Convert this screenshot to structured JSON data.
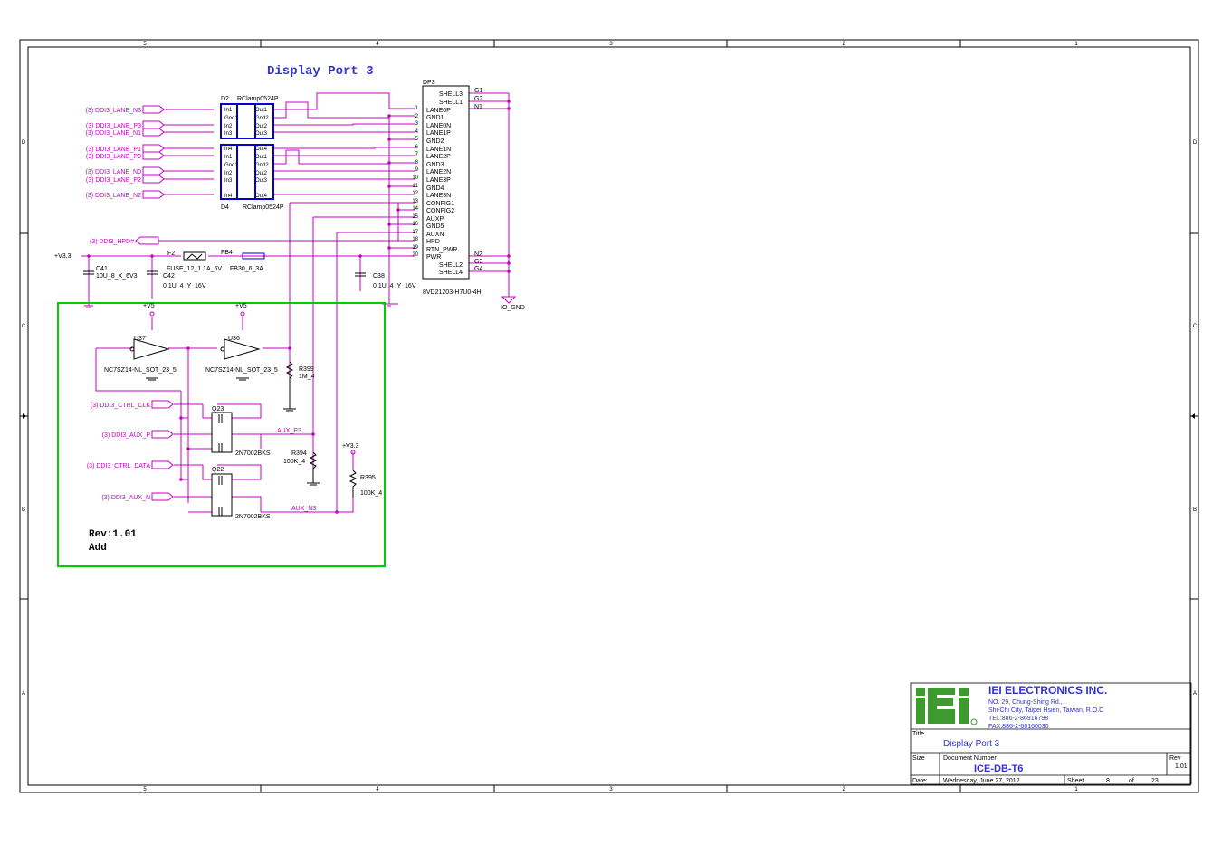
{
  "sheet": {
    "title": "Display Port 3",
    "border_cols": [
      "5",
      "4",
      "3",
      "2",
      "1"
    ],
    "border_rows": [
      "D",
      "C",
      "B",
      "A"
    ],
    "rev_note": [
      "Rev:1.01",
      "Add"
    ]
  },
  "nets": {
    "left_inputs": [
      "(3)  DDI3_LANE_N3",
      "(3)  DDI3_LANE_P3",
      "(3)  DDI3_LANE_N1",
      "(3)  DDI3_LANE_P1",
      "(3)  DDI3_LANE_P0",
      "(3)  DDI3_LANE_N0",
      "(3)  DDI3_LANE_P2",
      "(3)  DDI3_LANE_N2"
    ],
    "hpd": "(3)  DDI3_HPD#",
    "ctrl": [
      "(3)   DDI3_CTRL_CLK",
      "(3)   DDI3_AUX_P",
      "(3)   DDI3_CTRL_DATA",
      "(3)   DDI3_AUX_N"
    ],
    "aux_p": "AUX_P3",
    "aux_n": "AUX_N3",
    "io_gnd": "IO_GND",
    "v33": "+V3.3",
    "v5": "+V5"
  },
  "parts": {
    "d2": {
      "ref": "D2",
      "value": "RClamp0524P"
    },
    "d4": {
      "ref": "D4",
      "value": "RClamp0524P"
    },
    "clamp_pins_left": [
      "In1",
      "Gnd1",
      "In2",
      "In3",
      "In4"
    ],
    "clamp_pins_right": [
      "Out1",
      "Gnd2",
      "Out2",
      "Out3",
      "Out4"
    ],
    "dp3": {
      "ref": "DP3",
      "value": "8VD21203-H7U0-4H"
    },
    "dp3_pins": [
      "SHELL3",
      "SHELL1",
      "LANE0P",
      "GND1",
      "LANE0N",
      "LANE1P",
      "GND2",
      "LANE1N",
      "LANE2P",
      "GND3",
      "LANE2N",
      "LANE3P",
      "GND4",
      "LANE3N",
      "CONFIG1",
      "CONFIG2",
      "AUXP",
      "GND5",
      "AUXN",
      "HPD",
      "RTN_PWR",
      "PWR",
      "SHELL2",
      "SHELL4"
    ],
    "g_labels": [
      "G1",
      "G2",
      "N1",
      "N2",
      "G3",
      "G4"
    ],
    "f2": {
      "ref": "F2",
      "value": "FUSE_12_1.1A_6V"
    },
    "fb4": {
      "ref": "FB4",
      "value": "FB30_6_3A"
    },
    "c41": {
      "ref": "C41",
      "value": "10U_8_X_6V3"
    },
    "c42": {
      "ref": "C42",
      "value": "0.1U_4_Y_16V"
    },
    "c38": {
      "ref": "C38",
      "value": "0.1U_4_Y_16V"
    },
    "u37": {
      "ref": "U37",
      "value": "NC7SZ14-NL_SOT_23_5"
    },
    "u36": {
      "ref": "U36",
      "value": "NC7SZ14-NL_SOT_23_5"
    },
    "r399": {
      "ref": "R399",
      "value": "1M_4"
    },
    "r394": {
      "ref": "R394",
      "value": "100K_4"
    },
    "r395": {
      "ref": "R395",
      "value": "100K_4"
    },
    "q23": {
      "ref": "Q23",
      "value": "2N7002BKS"
    },
    "q22": {
      "ref": "Q22",
      "value": "2N7002BKS"
    }
  },
  "titleblock": {
    "logo": "iEi",
    "company": "IEI ELECTRONICS INC.",
    "address": [
      "NO. 29, Chung-Shing Rd.,",
      "Shi-Chi City, Taipei Hsien, Taiwan, R.O.C",
      "TEL:886-2-86916798",
      "FAX:886-2-66160030"
    ],
    "title_label": "Title",
    "title": "Display Port 3",
    "size_label": "Size",
    "docnum_label": "Document Number",
    "docnum": "ICE-DB-T6",
    "rev_label": "Rev",
    "rev": "1.01",
    "date_label": "Date:",
    "date": "Wednesday, June 27, 2012",
    "sheet_label": "Sheet",
    "sheet_num": "8",
    "of_label": "of",
    "sheet_total": "23"
  },
  "colors": {
    "wire": "#c800c8",
    "text": "#3333cc",
    "frame": "#000000",
    "highlight": "#00cc00",
    "logo": "#3c9a2e"
  }
}
